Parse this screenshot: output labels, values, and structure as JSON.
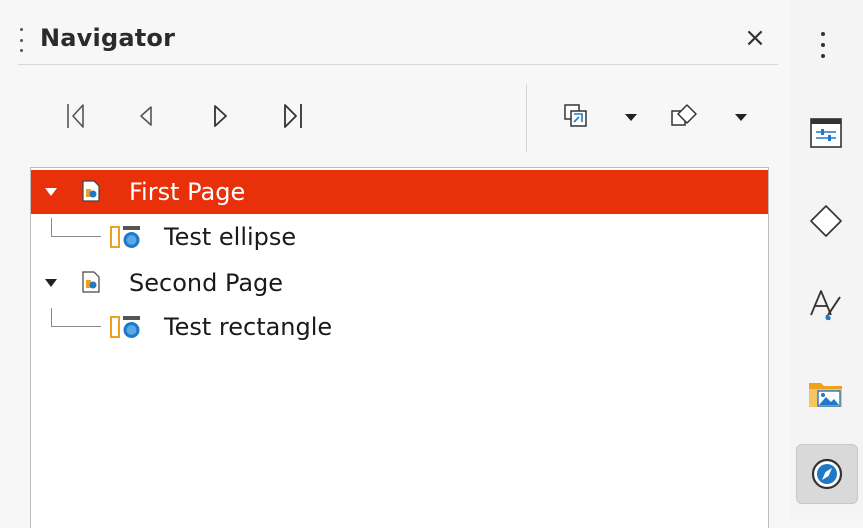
{
  "panel": {
    "title": "Navigator",
    "close_symbol": "×"
  },
  "toolbar": {
    "buttons": [
      {
        "name": "first-page-icon"
      },
      {
        "name": "previous-page-icon"
      },
      {
        "name": "next-page-icon"
      },
      {
        "name": "last-page-icon"
      },
      {
        "name": "drag-mode-icon"
      },
      {
        "name": "shapes-icon"
      }
    ]
  },
  "tree": {
    "items": [
      {
        "label": "First Page",
        "type": "page",
        "expanded": true,
        "selected": true
      },
      {
        "label": "Test ellipse",
        "type": "shape",
        "level": 1
      },
      {
        "label": "Second Page",
        "type": "page",
        "expanded": true,
        "selected": false
      },
      {
        "label": "Test rectangle",
        "type": "shape",
        "level": 1
      }
    ]
  },
  "deck": {
    "buttons": [
      {
        "name": "properties-icon"
      },
      {
        "name": "slide-transition-icon"
      },
      {
        "name": "styles-icon"
      },
      {
        "name": "gallery-icon"
      },
      {
        "name": "navigator-icon",
        "active": true
      }
    ]
  },
  "colors": {
    "selection": "#e8300b",
    "accent_blue": "#1f78c8",
    "accent_orange": "#f0a020"
  }
}
